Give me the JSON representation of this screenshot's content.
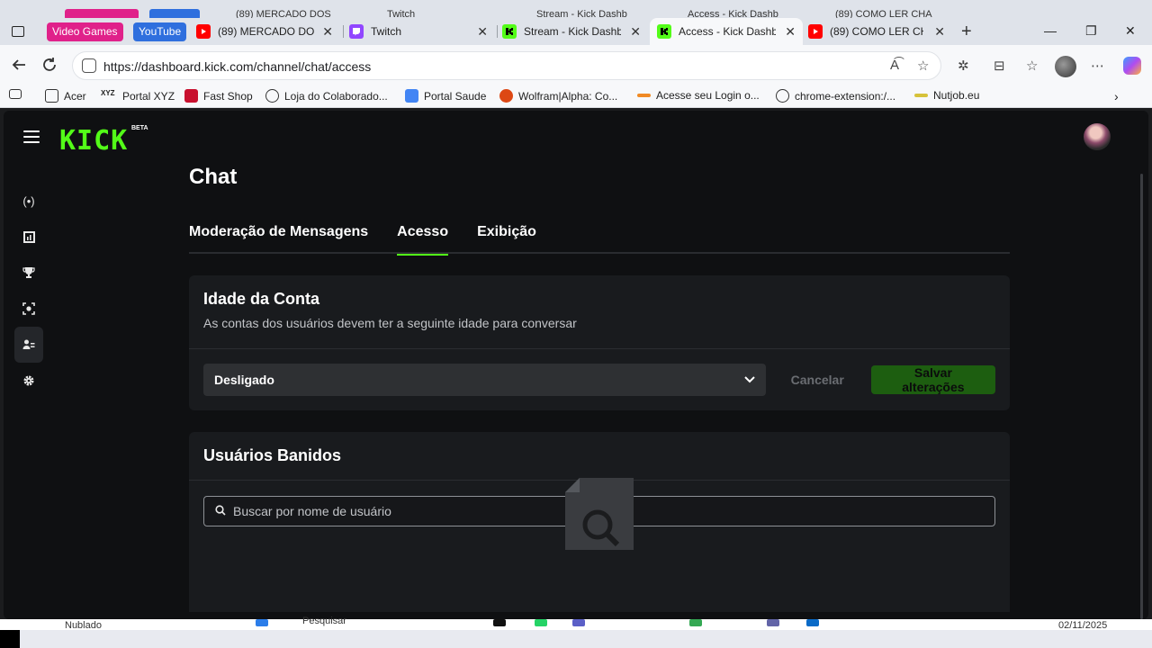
{
  "browser": {
    "ghost_tabs": [
      "Video Games",
      "YouTube",
      "(89) MERCADO DOS",
      "Twitch",
      "Stream - Kick Dashb",
      "Access - Kick Dashb",
      "(89) COMO LER CHA"
    ],
    "tab_groups": [
      {
        "label": "Video Games",
        "color": "#e0218a"
      },
      {
        "label": "YouTube",
        "color": "#2f6fde"
      }
    ],
    "tabs": [
      {
        "title": "(89) MERCADO DOS",
        "favicon": "youtube-icon"
      },
      {
        "title": "Twitch",
        "favicon": "twitch-icon"
      },
      {
        "title": "Stream - Kick Dashb",
        "favicon": "kick-icon"
      },
      {
        "title": "Access - Kick Dashb",
        "favicon": "kick-icon",
        "active": true
      },
      {
        "title": "(89) COMO LER CHA",
        "favicon": "youtube-icon"
      }
    ],
    "url": "https://dashboard.kick.com/channel/chat/access",
    "bookmarks": [
      {
        "label": "Acer"
      },
      {
        "label": "Portal XYZ"
      },
      {
        "label": "Fast Shop"
      },
      {
        "label": "Loja do Colaborado..."
      },
      {
        "label": "Portal Saude"
      },
      {
        "label": "Wolfram|Alpha: Co..."
      },
      {
        "label": "Acesse seu Login o..."
      },
      {
        "label": "chrome-extension:/..."
      },
      {
        "label": "Nutjob.eu"
      }
    ]
  },
  "app": {
    "logo": "KICK",
    "logo_badge": "BETA",
    "accent": "#53fc18",
    "page_title": "Chat",
    "tabs": [
      "Moderação de Mensagens",
      "Acesso",
      "Exibição"
    ],
    "active_tab": "Acesso",
    "account_age": {
      "title": "Idade da Conta",
      "subtitle": "As contas dos usuários devem ter a seguinte idade para conversar",
      "selected": "Desligado",
      "cancel_label": "Cancelar",
      "save_label": "Salvar alterações"
    },
    "banned": {
      "title": "Usuários Banidos",
      "search_placeholder": "Buscar por nome de usuário"
    }
  },
  "taskbar": {
    "weather": "Nublado",
    "search": "Pesquisar",
    "date": "02/11/2025"
  }
}
